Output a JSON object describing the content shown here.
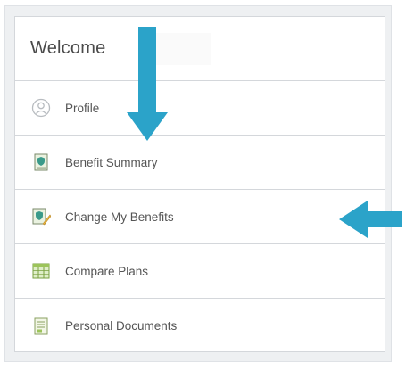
{
  "panel": {
    "welcome_title": "Welcome"
  },
  "menu": {
    "items": [
      {
        "label": "Profile",
        "icon": "profile-icon"
      },
      {
        "label": "Benefit Summary",
        "icon": "benefit-summary-icon"
      },
      {
        "label": "Change My Benefits",
        "icon": "change-benefits-icon"
      },
      {
        "label": "Compare Plans",
        "icon": "compare-plans-icon"
      },
      {
        "label": "Personal Documents",
        "icon": "personal-documents-icon"
      }
    ]
  },
  "colors": {
    "arrow": "#2ba3c9",
    "border": "#d4d7db",
    "text": "#555555"
  }
}
